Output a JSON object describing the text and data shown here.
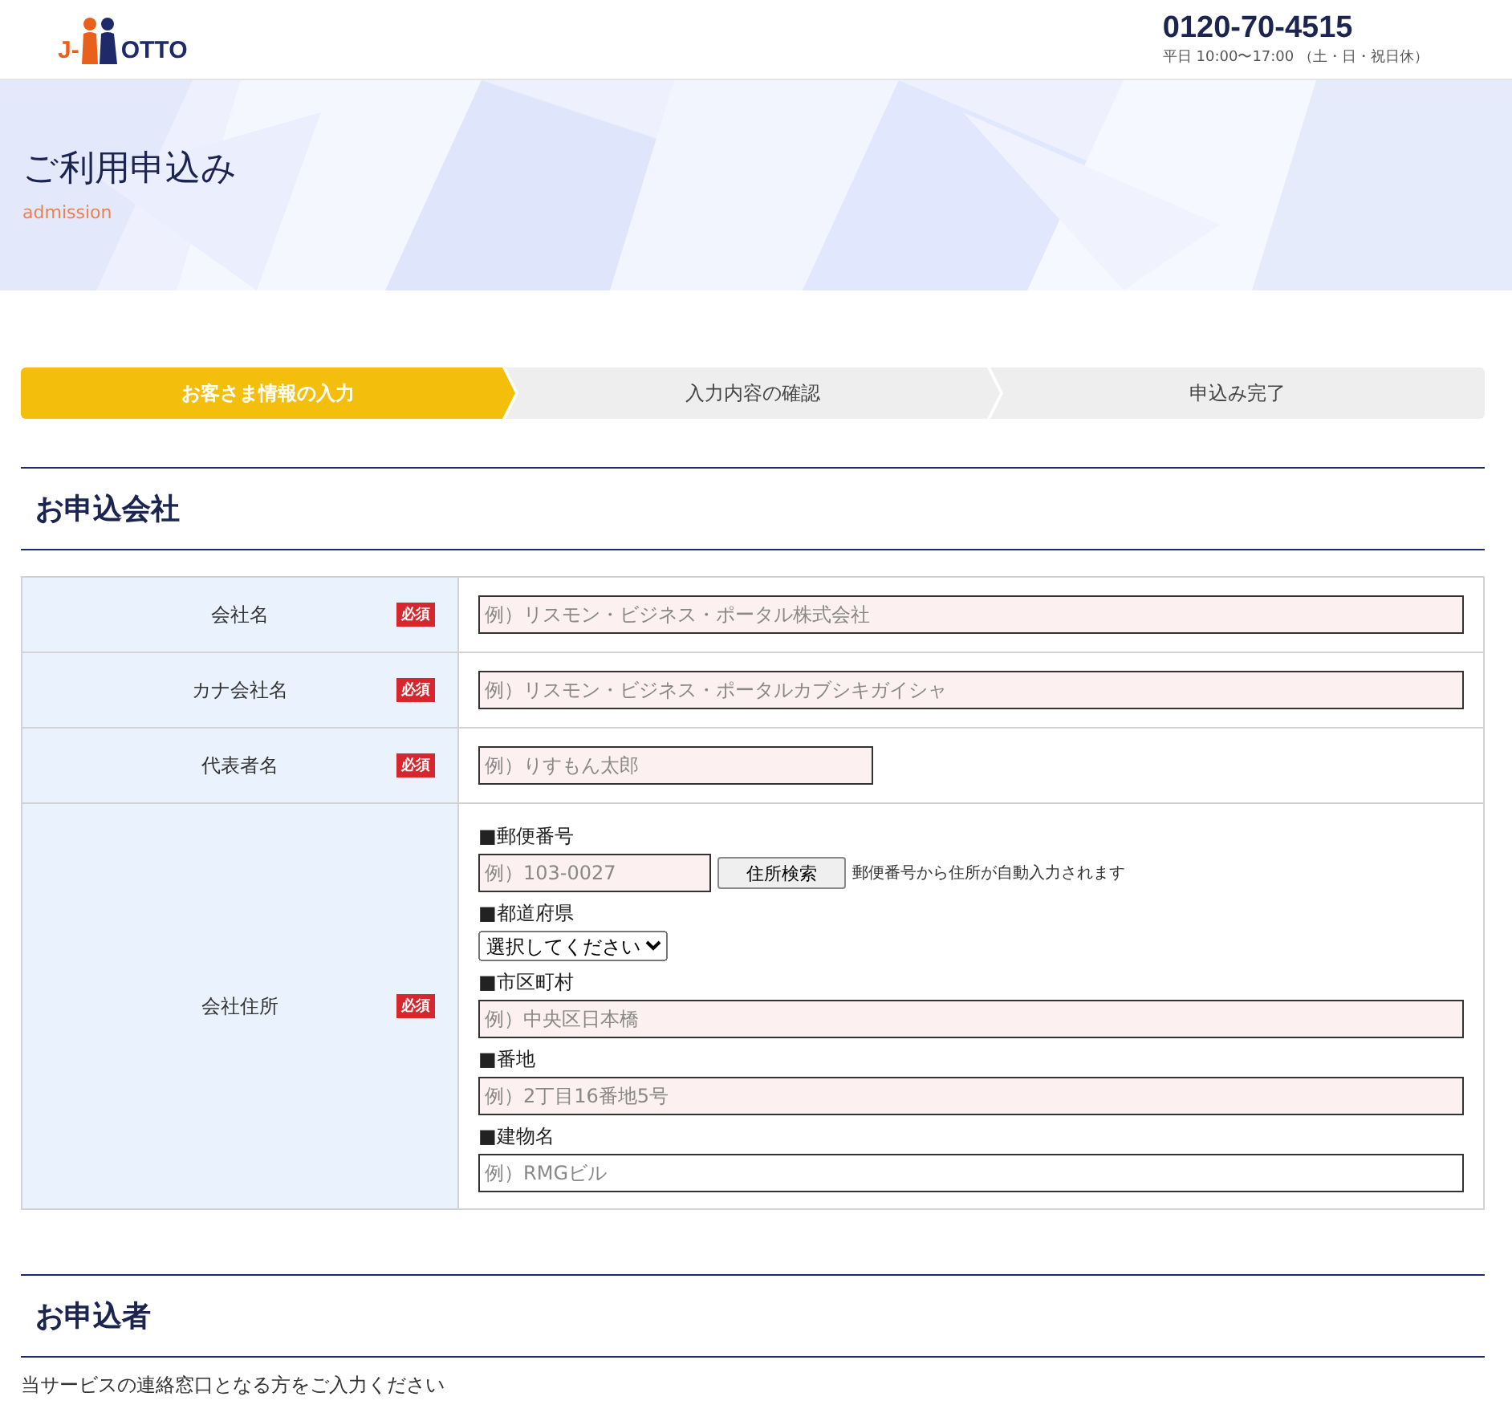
{
  "header": {
    "logo": {
      "prefix": "J-",
      "name": "OTTO"
    },
    "phone": "0120-70-4515",
    "hours": "平日 10:00〜17:00 （土・日・祝日休）"
  },
  "hero": {
    "title": "ご利用申込み",
    "subtitle": "admission"
  },
  "steps": [
    {
      "label": "お客さま情報の入力",
      "selected": true
    },
    {
      "label": "入力内容の確認",
      "selected": false
    },
    {
      "label": "申込み完了",
      "selected": false
    }
  ],
  "company_section": {
    "title": "お申込会社",
    "rows": [
      {
        "label": "会社名",
        "required": true,
        "badge": "必須",
        "kind": "text",
        "field": {
          "placeholder": "例）リスモン・ビジネス・ポータル株式会社",
          "required": true
        }
      },
      {
        "label": "カナ会社名",
        "required": true,
        "badge": "必須",
        "kind": "text",
        "field": {
          "placeholder": "例）リスモン・ビジネス・ポータルカブシキガイシャ",
          "required": true
        }
      },
      {
        "label": "代表者名",
        "required": true,
        "badge": "必須",
        "kind": "short_text",
        "field": {
          "placeholder": "例）りすもん太郎",
          "required": true
        }
      },
      {
        "label": "会社住所",
        "required": true,
        "badge": "必須",
        "kind": "address",
        "parts": [
          {
            "kind": "postal",
            "label": "■郵便番号",
            "placeholder": "例）103-0027",
            "required": true,
            "button": "住所検索",
            "note": "郵便番号から住所が自動入力されます"
          },
          {
            "kind": "select",
            "label": "■都道府県",
            "value": "選択してください"
          },
          {
            "kind": "text",
            "label": "■市区町村",
            "placeholder": "例）中央区日本橋",
            "required": true
          },
          {
            "kind": "text",
            "label": "■番地",
            "placeholder": "例）2丁目16番地5号",
            "required": true
          },
          {
            "kind": "text",
            "label": "■建物名",
            "placeholder": "例）RMGビル",
            "required": false
          }
        ]
      }
    ]
  },
  "applicant_section": {
    "title": "お申込者",
    "intro": "当サービスの連絡窓口となる方をご入力ください"
  }
}
